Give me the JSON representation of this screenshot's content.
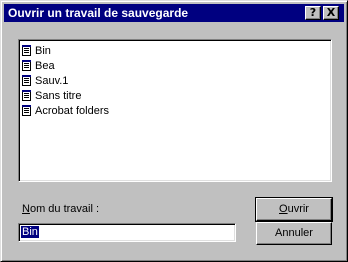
{
  "window": {
    "title": "Ouvrir un travail de sauvegarde",
    "help_label": "?",
    "close_label": "X"
  },
  "file_list": {
    "items": [
      {
        "label": "Bin",
        "icon": "document-icon"
      },
      {
        "label": "Bea",
        "icon": "document-icon"
      },
      {
        "label": "Sauv.1",
        "icon": "document-icon"
      },
      {
        "label": "Sans titre",
        "icon": "document-icon"
      },
      {
        "label": "Acrobat folders",
        "icon": "document-icon"
      }
    ]
  },
  "job_name": {
    "label_mnemonic": "N",
    "label_rest": "om du travail :",
    "value": "Bin"
  },
  "buttons": {
    "open_mnemonic": "O",
    "open_rest": "uvrir",
    "cancel": "Annuler"
  }
}
